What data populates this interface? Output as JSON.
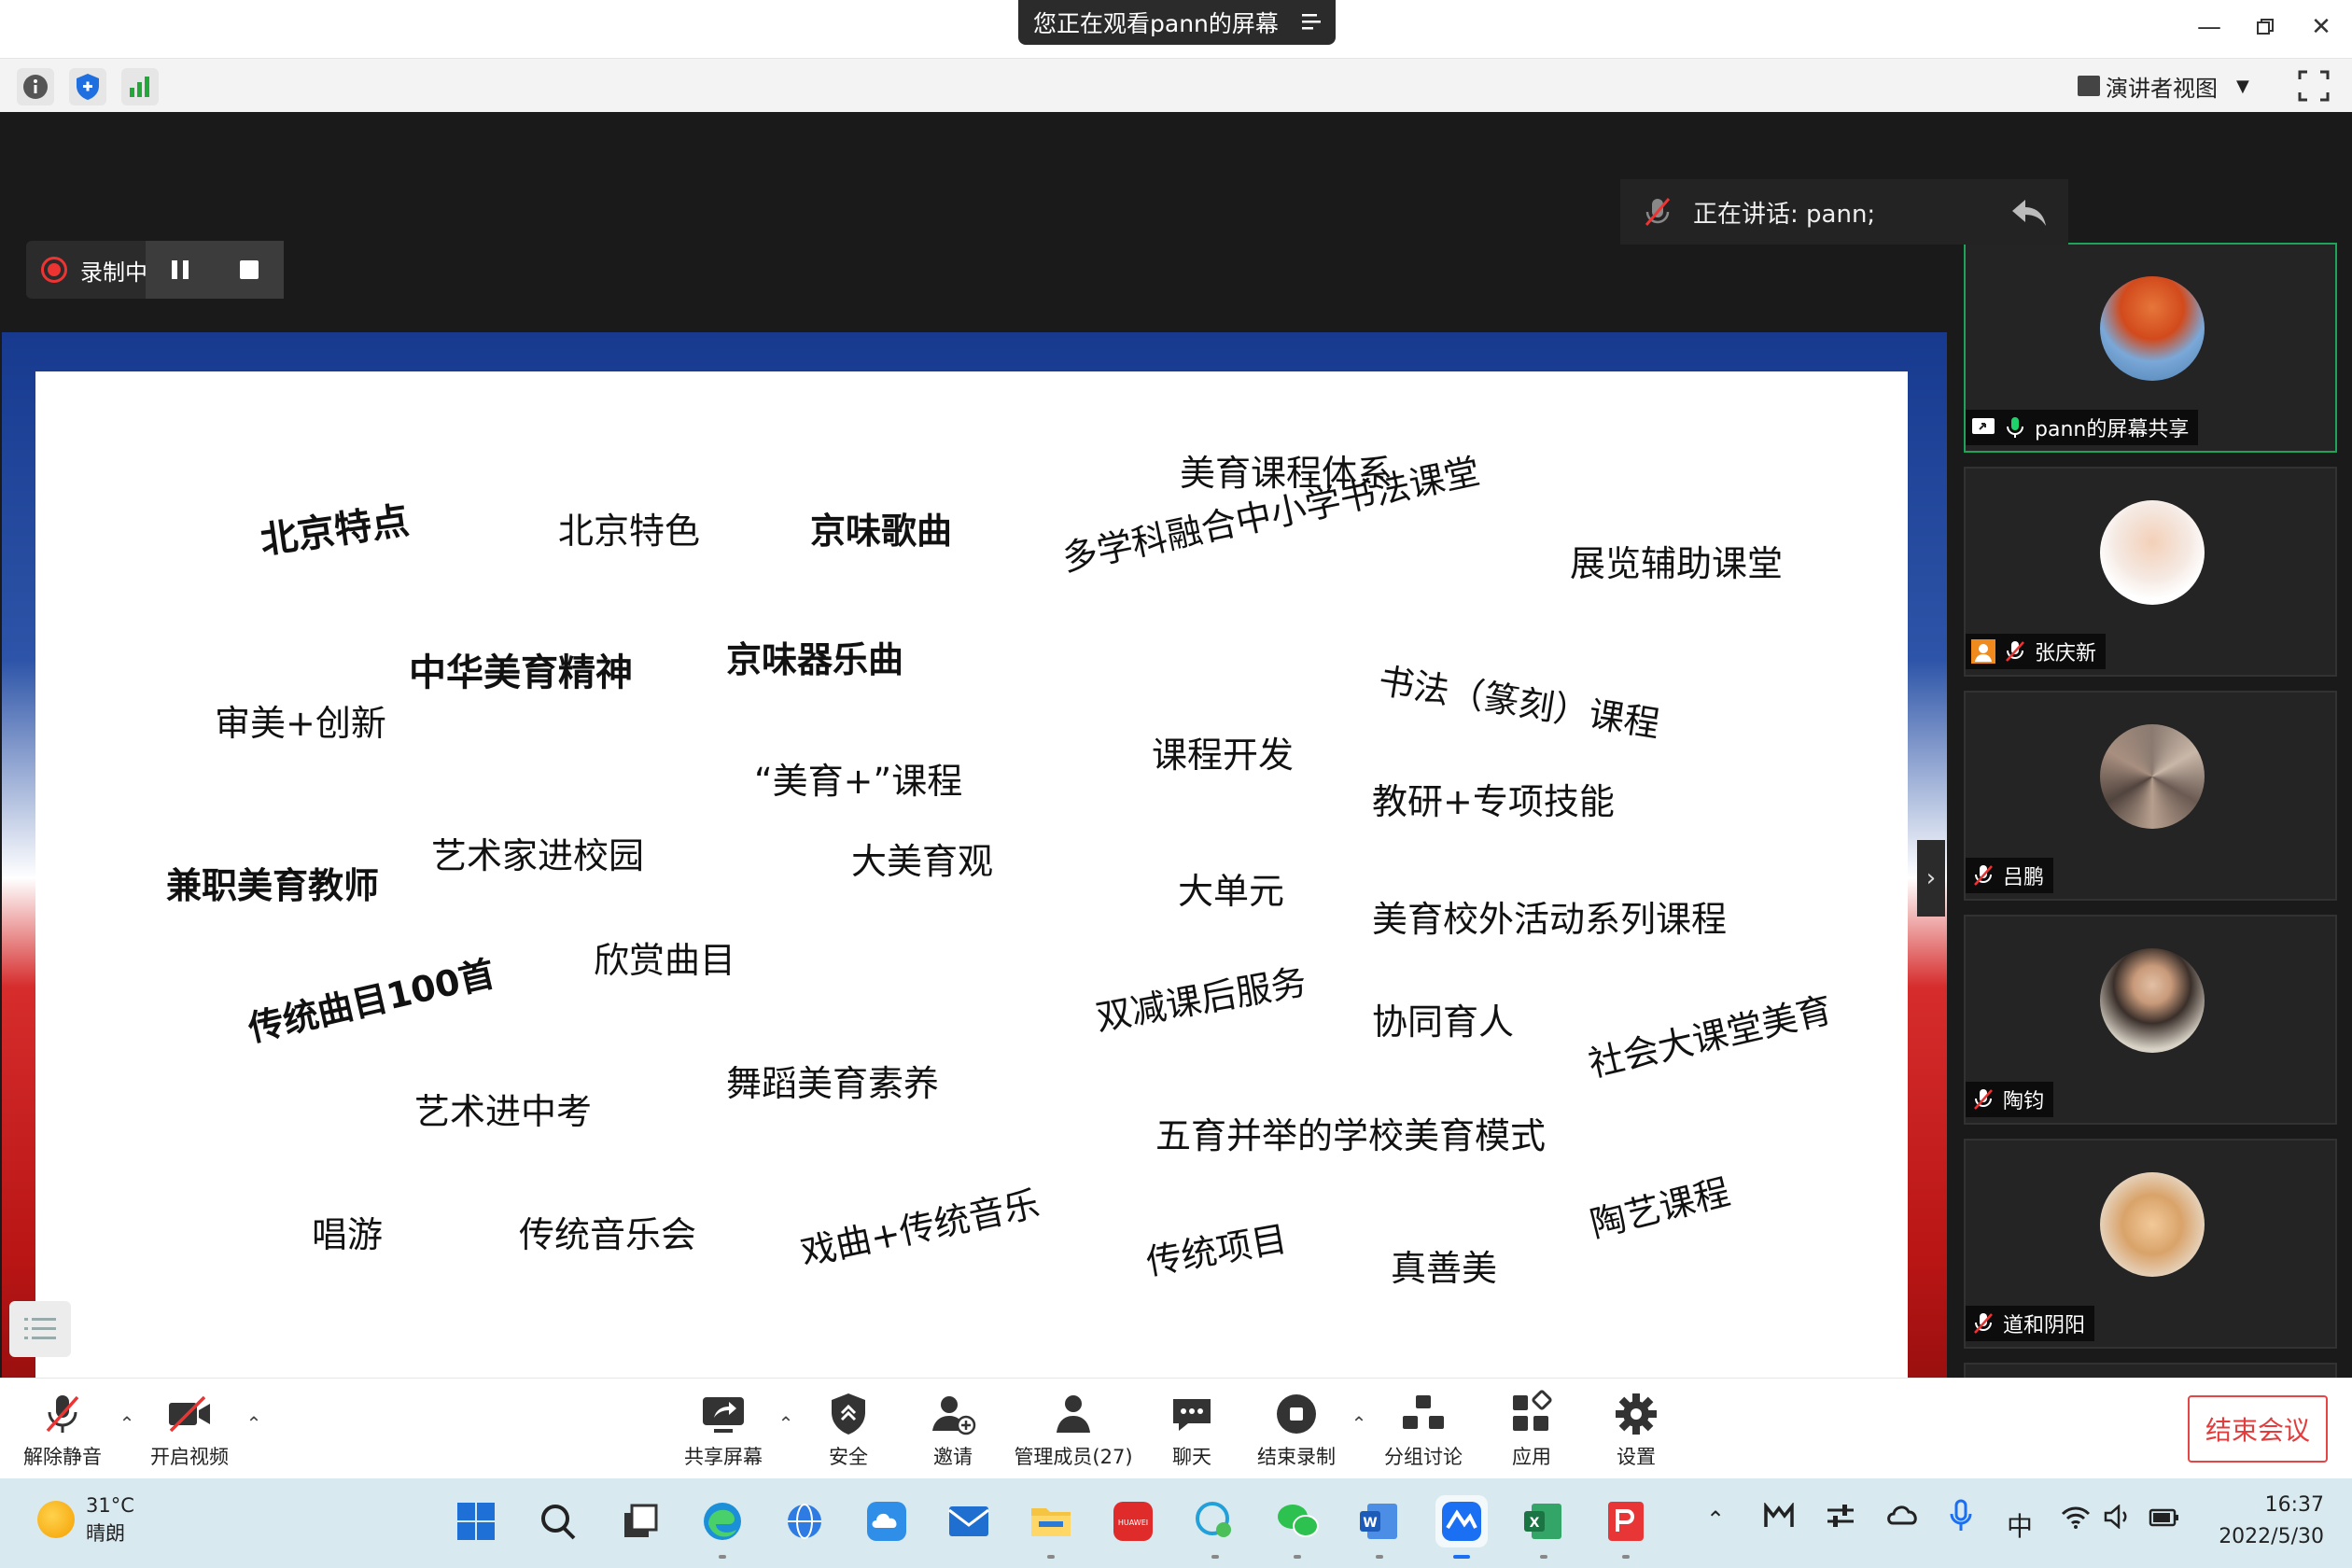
{
  "titlebar": {
    "title": "您正在观看pann的屏幕"
  },
  "infobar": {
    "view_label": "演讲者视图"
  },
  "meeting": {
    "speaking_text": "正在讲话: pann;",
    "recording_label": "录制中"
  },
  "slide": {
    "words": [
      "美育课程体系",
      "北京特点",
      "北京特色",
      "京味歌曲",
      "多学科融合中小学书法课堂",
      "展览辅助课堂",
      "中华美育精神",
      "京味器乐曲",
      "书法（篆刻）课程",
      "审美+创新",
      "“美育+”课程",
      "课程开发",
      "教研+专项技能",
      "兼职美育教师",
      "艺术家进校园",
      "大美育观",
      "大单元",
      "美育校外活动系列课程",
      "欣赏曲目",
      "传统曲目100首",
      "双减课后服务",
      "协同育人",
      "社会大课堂美育",
      "舞蹈美育素养",
      "艺术进中考",
      "五育并举的学校美育模式",
      "陶艺课程",
      "唱游",
      "传统音乐会",
      "戏曲+传统音乐",
      "传统项目",
      "真善美"
    ]
  },
  "participants": [
    {
      "name": "pann的屏幕共享"
    },
    {
      "name": "张庆新"
    },
    {
      "name": "吕鹏"
    },
    {
      "name": "陶钧"
    },
    {
      "name": "道和阴阳"
    }
  ],
  "toolbar": {
    "unmute": "解除静音",
    "start_video": "开启视频",
    "share_screen": "共享屏幕",
    "security": "安全",
    "invite": "邀请",
    "manage_members": "管理成员(27)",
    "chat": "聊天",
    "stop_recording": "结束录制",
    "breakout": "分组讨论",
    "apps": "应用",
    "settings": "设置",
    "end_meeting": "结束会议"
  },
  "taskbar": {
    "temperature": "31°C",
    "weather": "晴朗",
    "ime": "中",
    "time": "16:37",
    "date": "2022/5/30"
  },
  "colors": {
    "accent_green": "#1fa35a",
    "end_red": "#e23c3c",
    "record_red": "#e33333"
  }
}
